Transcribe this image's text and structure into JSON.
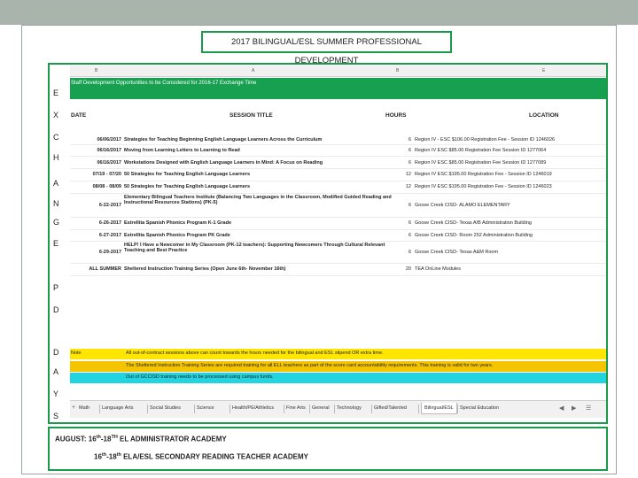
{
  "slide_title": "2017 BILINGUAL/ESL SUMMER PROFESSIONAL DEVELOPMENT",
  "side_letters": [
    "E",
    "X",
    "C",
    "H",
    "A",
    "N",
    "G",
    "E",
    "P",
    "D",
    "D",
    "A",
    "Y",
    "S"
  ],
  "sheet": {
    "column_letters": [
      "B",
      "A",
      "B",
      "E"
    ],
    "title_row": "Staff Development Opportunities to be Considered for 2016-17 Exchange Time",
    "headers": {
      "date": "DATE",
      "title": "SESSION TITLE",
      "hours": "HOURS",
      "location": "LOCATION"
    },
    "rows": [
      {
        "date": "06/06/2017",
        "title": "Strategies for Teaching Beginning English Language Learners Across the Curriculum",
        "hours": "6",
        "location": "Region IV - ESC   $106.00 Registration Fee - Session ID 1246026"
      },
      {
        "date": "06/16/2017",
        "title": "Moving from Learning Letters to Learning to Read",
        "hours": "6",
        "location": "Region IV ESC $85.00 Registration Fee   Session ID 1277064"
      },
      {
        "date": "06/16/2017",
        "title": "Workstations Designed with English Language Learners in Mind: A Focus on Reading",
        "hours": "6",
        "location": "Region IV ESC   $85.00 Registration Fee   Session ID 1277089"
      },
      {
        "date": "07/19 - 07/20",
        "title": "50 Strategies for Teaching English Language Learners",
        "hours": "12",
        "location": "Region IV ESC   $195.00 Registration Fee - Session ID 1246019"
      },
      {
        "date": "08/08 - 08/09",
        "title": "50 Strategies for Teaching English Language Learners",
        "hours": "12",
        "location": "Region IV ESC   $195.00 Registration Fee - Session ID 1246023"
      },
      {
        "date": "6-22-2017",
        "title": "Elementary Bilingual Teachers Institute (Balancing Two Languages in the Classroom, Modified Guided Reading and Instructional Resources Stations) (PK-5)",
        "hours": "6",
        "location": "Goose Creek CISD- ALAMO ELEMENTARY"
      },
      {
        "date": "6-26-2017",
        "title": "Estrellita Spanish Phonics Program K-1 Grade",
        "hours": "6",
        "location": "Goose Creek CISD- Texas A/B Administration Building"
      },
      {
        "date": "6-27-2017",
        "title": "Estrellita Spanish Phonics Program PK Grade",
        "hours": "6",
        "location": "Goose Creek CISD- Room 252 Administration Building"
      },
      {
        "date": "6-29-2017",
        "title": "HELP! I Have a Newcomer in My Classroom (PK-12 teachers): Supporting Newcomers Through Cultural Relevant Teaching and Best Practice",
        "hours": "6",
        "location": "Goose Creek CISD- Texas A&M Room"
      },
      {
        "date": "ALL SUMMER",
        "title": "Sheltered Instruction Training Series (Open June 6th- November 16th)",
        "hours": "20",
        "location": "TEA OnLine Modules"
      }
    ],
    "notes": [
      {
        "label": "Note",
        "text": "All out-of-contract sessions above can count towards the hours needed for the bilingual and ESL stipend OR extra time.",
        "color": "#ffe600"
      },
      {
        "label": "",
        "text": "The Sheltered Instruction Training Series are required training for all ELL teachers as part of the score card accountability requirements. This training is valid for two years.",
        "color": "#f5c400"
      },
      {
        "label": "",
        "text": "Out of GCCISD training needs to be processed using campus funds.",
        "color": "#22d3e0"
      }
    ],
    "tabs": [
      "Math",
      "Language Arts",
      "Social Studies",
      "Science",
      "Health/PE/Athletics",
      "Fine Arts",
      "General",
      "Technology",
      "Gifted/Talented",
      "Bilingual/ESL",
      "Special Education"
    ],
    "active_tab": "Bilingual/ESL",
    "accent_color": "#17a050"
  },
  "academies": {
    "line1_prefix": "AUGUST:  16",
    "line1_sup1": "th",
    "line1_mid": "-18",
    "line1_sup2": "TH",
    "line1_suffix": " EL ADMINISTRATOR ACADEMY",
    "line2_prefix": "16",
    "line2_sup1": "th",
    "line2_mid": "-18",
    "line2_sup2": "th",
    "line2_suffix": " ELA/ESL SECONDARY READING TEACHER ACADEMY"
  }
}
